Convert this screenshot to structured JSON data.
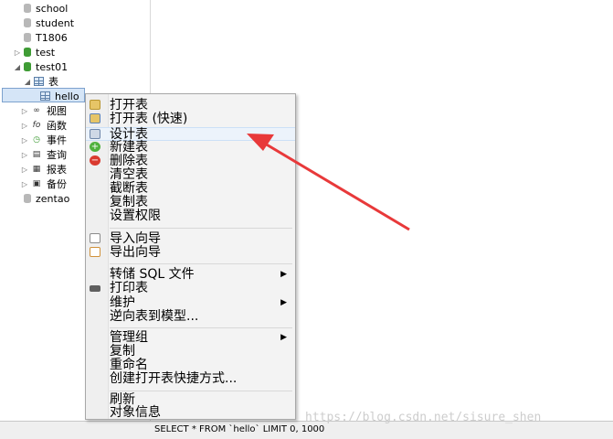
{
  "tree": {
    "items": [
      {
        "label": "school"
      },
      {
        "label": "student"
      },
      {
        "label": "T1806"
      },
      {
        "label": "test"
      },
      {
        "label": "test01"
      },
      {
        "label": "表"
      },
      {
        "label": "hello"
      },
      {
        "label": "视图"
      },
      {
        "label": "函数"
      },
      {
        "label": "事件"
      },
      {
        "label": "查询"
      },
      {
        "label": "报表"
      },
      {
        "label": "备份"
      },
      {
        "label": "zentao"
      }
    ]
  },
  "context_menu": {
    "items": [
      {
        "label": "打开表",
        "icon": "open-table-icon"
      },
      {
        "label": "打开表 (快速)",
        "icon": "open-table-fast-icon"
      },
      {
        "label": "设计表",
        "icon": "design-table-icon"
      },
      {
        "label": "新建表",
        "icon": "new-table-icon"
      },
      {
        "label": "删除表",
        "icon": "delete-table-icon"
      },
      {
        "label": "清空表"
      },
      {
        "label": "截断表"
      },
      {
        "label": "复制表"
      },
      {
        "label": "设置权限"
      },
      {
        "label": "导入向导",
        "icon": "import-icon"
      },
      {
        "label": "导出向导",
        "icon": "export-icon"
      },
      {
        "label": "转储 SQL 文件",
        "submenu": true
      },
      {
        "label": "打印表",
        "icon": "printer-icon"
      },
      {
        "label": "维护",
        "submenu": true
      },
      {
        "label": "逆向表到模型..."
      },
      {
        "label": "管理组",
        "submenu": true
      },
      {
        "label": "复制"
      },
      {
        "label": "重命名"
      },
      {
        "label": "创建打开表快捷方式..."
      },
      {
        "label": "刷新"
      },
      {
        "label": "对象信息"
      }
    ]
  },
  "statusbar": {
    "sql": "SELECT * FROM `hello` LIMIT 0, 1000"
  },
  "watermark": "https://blog.csdn.net/sisure_shen",
  "colors": {
    "annotation_arrow": "#e8393a",
    "selection": "#d5e5f7"
  }
}
